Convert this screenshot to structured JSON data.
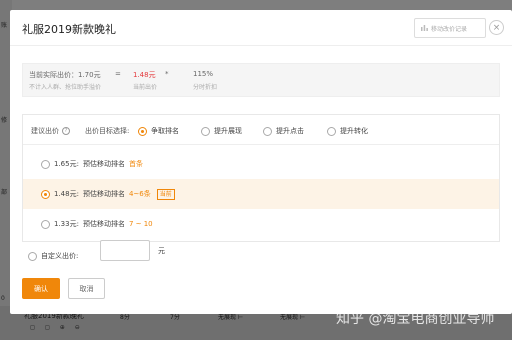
{
  "background": {
    "side_labels": [
      "账",
      "修",
      "部",
      "0"
    ],
    "row_title": "礼服2019新款晚礼",
    "row_icons": "◻ ◻ ⊕ ⊖",
    "cells": [
      "8分",
      "7分",
      "无展现 ⊢",
      "无展现 ⊢"
    ],
    "watermark": "知乎 @淘宝电商创业导师"
  },
  "modal": {
    "title": "礼服2019新款晚礼",
    "history_button": "移动改价记录",
    "close": "×"
  },
  "price_summary": {
    "current_label": "当前实际出价：1.70元",
    "current_sub": "不计入人群、抢位助手溢价",
    "eq": "=",
    "bid_value": "1.48元",
    "bid_sub": "当前出价",
    "times": "*",
    "discount_value": "115%",
    "discount_sub": "分时折扣"
  },
  "suggest": {
    "label": "建议出价",
    "help": "?",
    "goal_label": "出价目标选择:",
    "goals": [
      {
        "label": "争取排名",
        "selected": true
      },
      {
        "label": "提升展现",
        "selected": false
      },
      {
        "label": "提升点击",
        "selected": false
      },
      {
        "label": "提升转化",
        "selected": false
      }
    ],
    "options": [
      {
        "price": "1.65元:",
        "desc": "预估移动排名",
        "rank": "首条",
        "tag": "",
        "selected": false
      },
      {
        "price": "1.48元:",
        "desc": "预估移动排名",
        "rank": "4~6条",
        "tag": "当前",
        "selected": true
      },
      {
        "price": "1.33元:",
        "desc": "预估移动排名",
        "rank": "7 ~ 10",
        "tag": "",
        "selected": false
      }
    ]
  },
  "custom": {
    "label": "自定义出价:",
    "value": "",
    "unit": "元"
  },
  "buttons": {
    "confirm": "确认",
    "cancel": "取消"
  },
  "colors": {
    "accent": "#f0870a",
    "price_red": "#e4393c"
  }
}
